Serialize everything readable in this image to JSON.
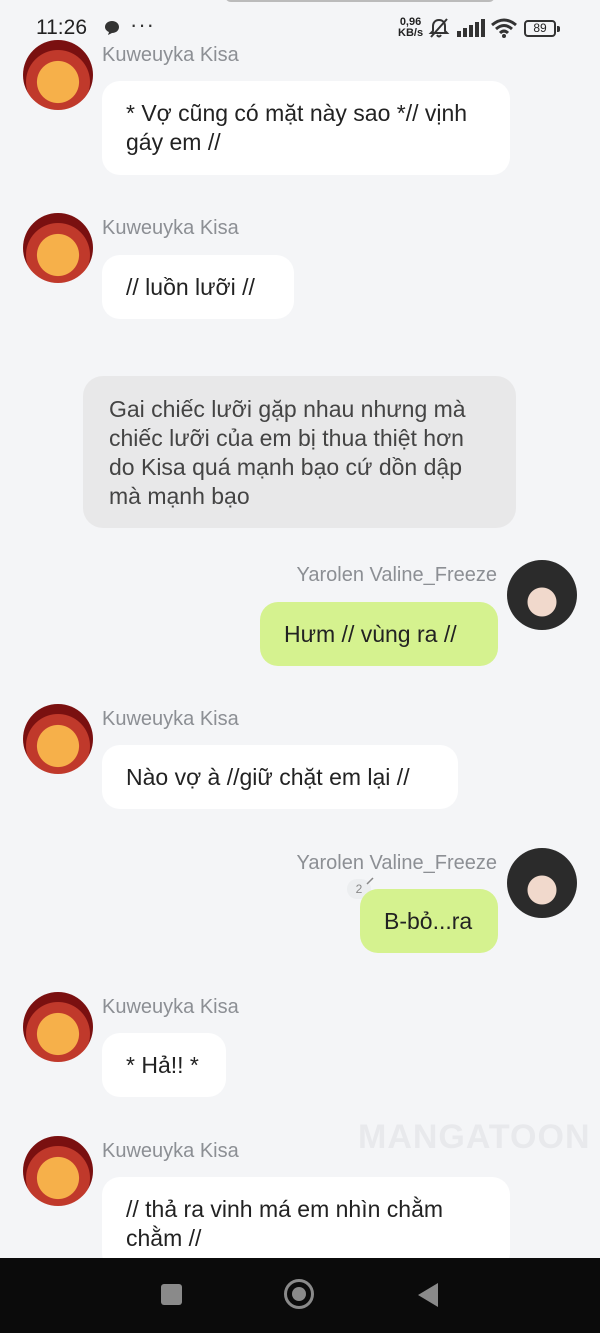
{
  "status_bar": {
    "time": "11:26",
    "more": "···",
    "net_speed_value": "0,96",
    "net_speed_unit": "KB/s",
    "battery": "89"
  },
  "messages": [
    {
      "sender": "Kuweuyka Kisa",
      "side": "left",
      "text": "* Vợ cũng có mặt này sao *// vịnh gáy em //"
    },
    {
      "sender": "Kuweuyka Kisa",
      "side": "left",
      "text": "// luồn lưỡi //"
    },
    {
      "sender": "",
      "side": "center",
      "text": "Gai chiếc lưỡi gặp nhau nhưng mà chiếc lưỡi của em bị thua thiệt hơn do Kisa quá mạnh bạo cứ dồn dập mà mạnh bạo"
    },
    {
      "sender": "Yarolen Valine_Freeze",
      "side": "right",
      "text": "Hưm // vùng ra //"
    },
    {
      "sender": "Kuweuyka Kisa",
      "side": "left",
      "text": "Nào vợ à //giữ chặt em lại //"
    },
    {
      "sender": "Yarolen Valine_Freeze",
      "side": "right",
      "text": "B-bỏ...ra",
      "edit_count": "2"
    },
    {
      "sender": "Kuweuyka Kisa",
      "side": "left",
      "text": "* Hả!! *"
    },
    {
      "sender": "Kuweuyka Kisa",
      "side": "left",
      "text": "// thả ra vinh má em nhìn chằm chằm //"
    }
  ],
  "watermark": "MANGATOON",
  "colors": {
    "background": "#f4f5f7",
    "bubble_left": "#ffffff",
    "bubble_right": "#d5f28f",
    "narration": "#e8e8e9",
    "sender_name": "#8c8f94"
  }
}
